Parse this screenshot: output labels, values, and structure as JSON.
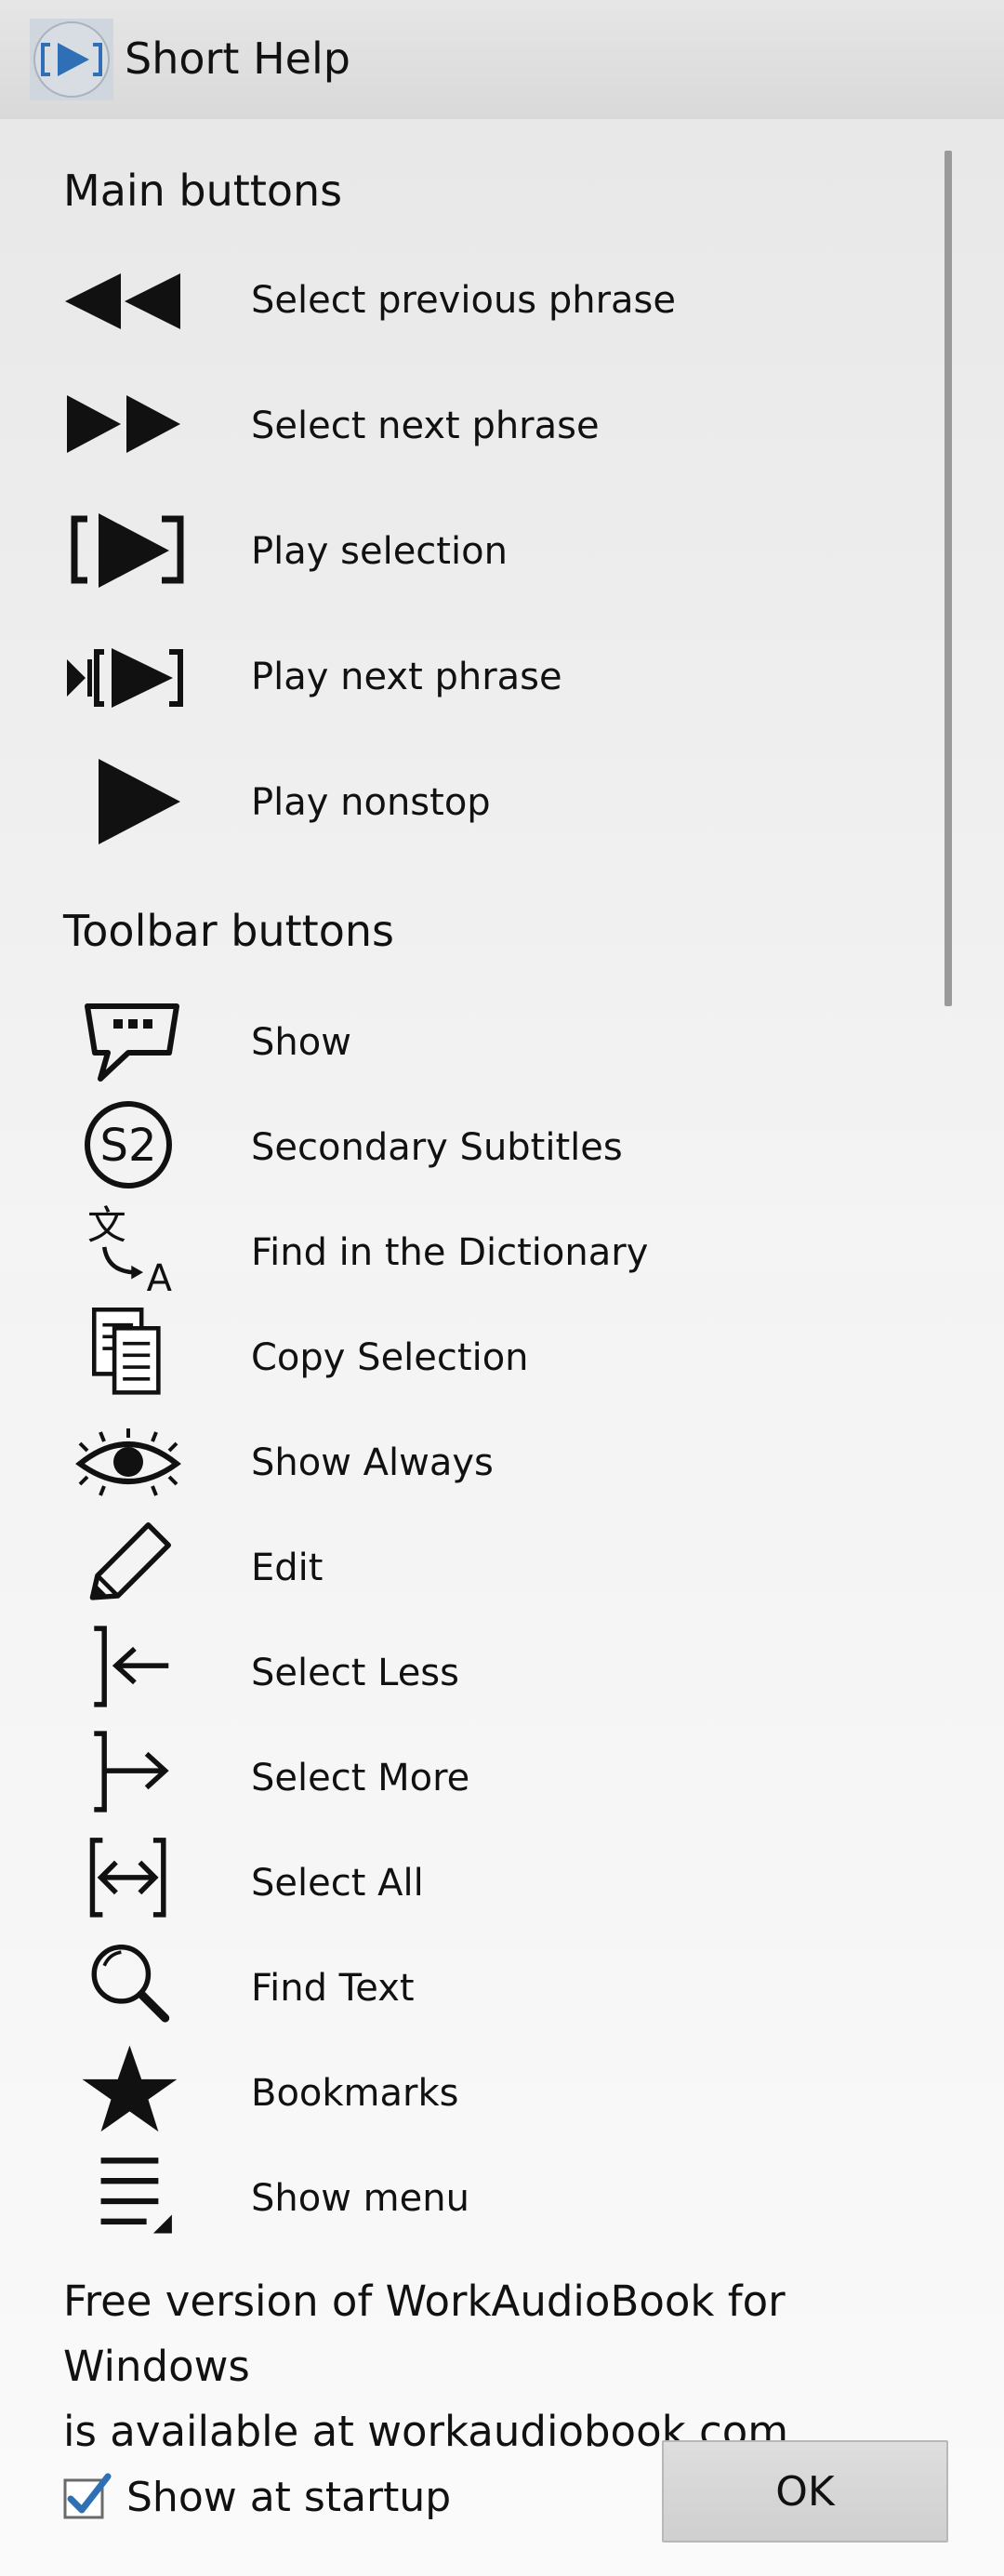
{
  "window": {
    "title": "Short Help",
    "accent": "#2f6fb5"
  },
  "main_section": {
    "title": "Main buttons",
    "items": [
      {
        "icon": "rewind-icon",
        "label": "Select previous phrase"
      },
      {
        "icon": "fast-forward-icon",
        "label": "Select next phrase"
      },
      {
        "icon": "play-selection-icon",
        "label": "Play selection"
      },
      {
        "icon": "play-next-phrase-icon",
        "label": "Play next phrase"
      },
      {
        "icon": "play-icon",
        "label": "Play nonstop"
      }
    ]
  },
  "toolbar_section": {
    "title": "Toolbar buttons",
    "items": [
      {
        "icon": "speech-bubble-icon",
        "label": "Show"
      },
      {
        "icon": "s2-circle-icon",
        "label": "Secondary Subtitles"
      },
      {
        "icon": "translate-icon",
        "label": "Find in the Dictionary"
      },
      {
        "icon": "copy-documents-icon",
        "label": "Copy Selection"
      },
      {
        "icon": "eye-icon",
        "label": "Show Always"
      },
      {
        "icon": "pencil-icon",
        "label": "Edit"
      },
      {
        "icon": "select-less-icon",
        "label": "Select Less"
      },
      {
        "icon": "select-more-icon",
        "label": "Select More"
      },
      {
        "icon": "select-all-icon",
        "label": "Select All"
      },
      {
        "icon": "magnifier-icon",
        "label": "Find Text"
      },
      {
        "icon": "star-icon",
        "label": "Bookmarks"
      },
      {
        "icon": "menu-icon",
        "label": "Show menu"
      }
    ]
  },
  "footer": {
    "line1": "Free version of WorkAudioBook for Windows",
    "line2": "is available at workaudiobook.com",
    "show_at_startup_label": "Show at startup",
    "show_at_startup_checked": true,
    "ok_label": "OK"
  }
}
